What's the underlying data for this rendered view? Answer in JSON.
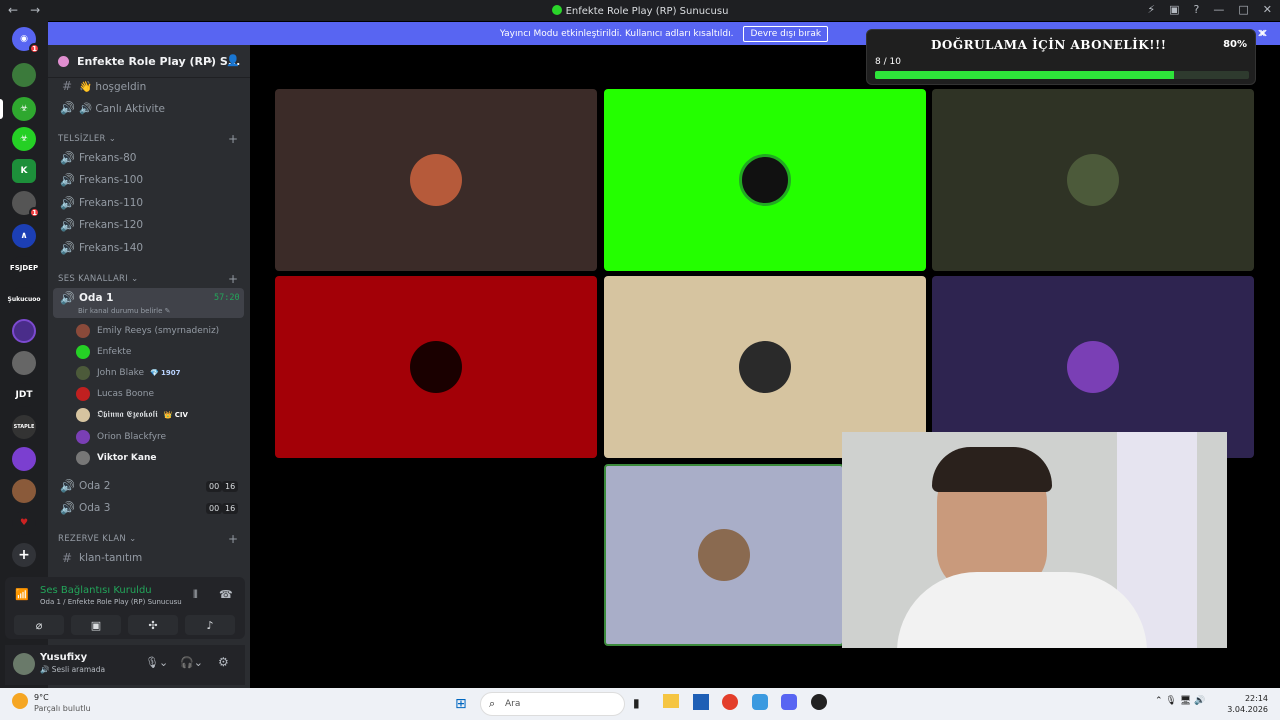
{
  "window": {
    "title": "Enfekte Role Play (RP) Sunucusu"
  },
  "banner": {
    "text": "Yayıncı Modu etkinleştirildi. Kullanıcı adları kısaltıldı.",
    "button": "Devre dışı bırak"
  },
  "server": {
    "name": "Enfekte Role Play (RP) S..."
  },
  "server_icons": [
    {
      "label": "1",
      "color": "#f23f43"
    },
    {
      "label": "",
      "color": "#3b7a3b"
    },
    {
      "label": "",
      "color": "#2fa82f"
    },
    {
      "label": "K",
      "color": "#1d8f3a"
    },
    {
      "label": "1",
      "color": "#f23f43"
    },
    {
      "label": "",
      "color": "#1c3fb5"
    },
    {
      "label": "FSJDEP"
    },
    {
      "label": "Şukucuoo"
    },
    {
      "label": "JDT"
    },
    {
      "label": "STAPLE"
    }
  ],
  "channels": {
    "top": [
      {
        "name": "👋 hoşgeldin"
      },
      {
        "name": "🔊 Canlı Aktivite"
      }
    ],
    "cat_telsizler": "TELSİZLER",
    "telsizler": [
      "Frekans-80",
      "Frekans-100",
      "Frekans-110",
      "Frekans-120",
      "Frekans-140"
    ],
    "cat_ses": "SES KANALLARI",
    "active": {
      "name": "Oda 1",
      "status": "Bir kanal durumu belirle",
      "timer": "57:20"
    },
    "members": [
      {
        "name": "Emily Reeys (smyrnadeniz)",
        "tag": ""
      },
      {
        "name": "Enfekte",
        "tag": ""
      },
      {
        "name": "John Blake",
        "tag": "1907"
      },
      {
        "name": "Lucas Boone",
        "tag": ""
      },
      {
        "name": "𝕺𝖇𝖎𝖓𝖓𝖆 𝕰𝖟𝖊𝖔𝖐𝖔𝖑𝖎",
        "tag": "CIV"
      },
      {
        "name": "Orion Blackfyre",
        "tag": ""
      },
      {
        "name": "Viktor Kane",
        "tag": ""
      }
    ],
    "others": [
      {
        "name": "Oda 2",
        "a": "00",
        "b": "16"
      },
      {
        "name": "Oda 3",
        "a": "00",
        "b": "16"
      }
    ],
    "cat_rezerve": "REZERVE KLAN",
    "rezerve": [
      {
        "name": "klan-tanıtım"
      }
    ]
  },
  "voice_panel": {
    "status": "Ses Bağlantısı Kuruldu",
    "sub": "Oda 1 / Enfekte Role Play (RP) Sunucusu"
  },
  "user": {
    "name": "Yusufixy",
    "status": "Sesli aramada"
  },
  "overlay": {
    "title": "DOĞRULAMA İÇİN ABONELİK!!!",
    "count": "8 / 10",
    "percent": "80%",
    "progress": 0.8
  },
  "tiles": [
    {
      "color": "#3b2b28",
      "avatar": "#b65a3a"
    },
    {
      "color": "#24ff00",
      "avatar": "#111"
    },
    {
      "color": "#2f3325",
      "avatar": "#4c5a3a"
    },
    {
      "color": "#a30007",
      "avatar": "#1a0000"
    },
    {
      "color": "#d6c4a0",
      "avatar": "#2a2a2a"
    },
    {
      "color": "#2e2450",
      "avatar": "#7a3fb5"
    },
    {
      "color": "#a9aec8",
      "avatar": "#8a6a50"
    }
  ],
  "taskbar": {
    "temp": "9°C",
    "weather": "Parçalı bulutlu",
    "search": "Ara",
    "time": "22:14",
    "date": "3.04.2026"
  }
}
